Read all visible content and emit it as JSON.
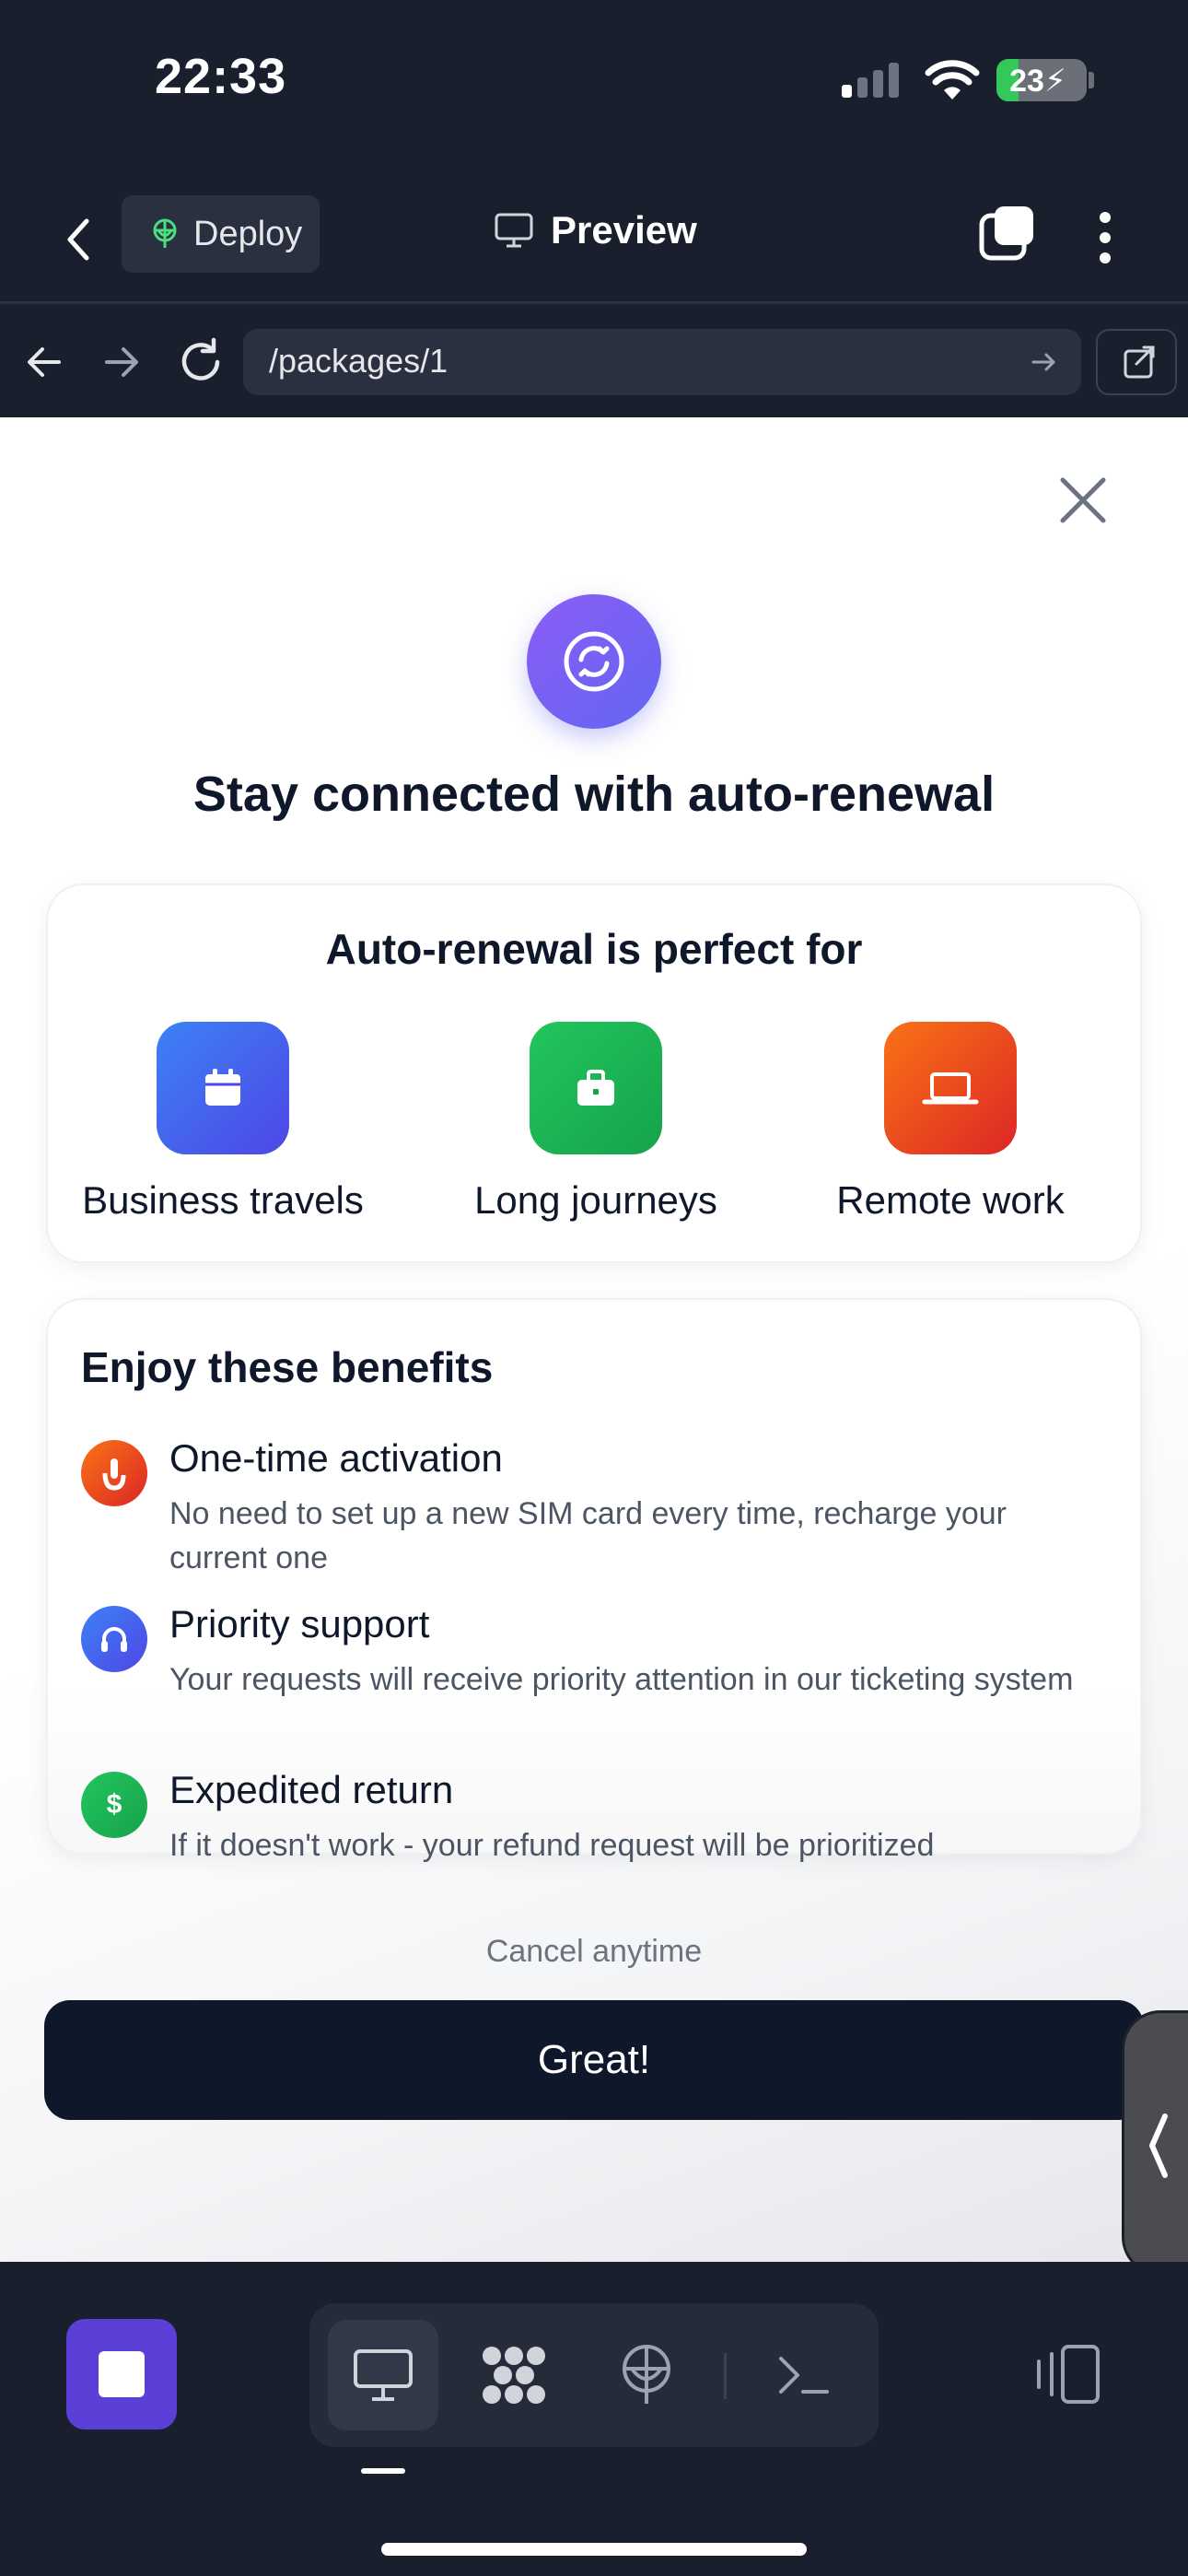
{
  "status_bar": {
    "time": "22:33",
    "battery_level": "23",
    "battery_charging": true
  },
  "header": {
    "deploy_label": "Deploy",
    "preview_label": "Preview"
  },
  "browser": {
    "url": "/packages/1"
  },
  "dialog": {
    "title": "Stay connected with auto-renewal",
    "perfect_for_title": "Auto-renewal is perfect for",
    "use_cases": [
      {
        "label": "Business travels",
        "icon": "calendar-icon",
        "color": "#4f46e5"
      },
      {
        "label": "Long journeys",
        "icon": "briefcase-icon",
        "color": "#16a34a"
      },
      {
        "label": "Remote work",
        "icon": "laptop-icon",
        "color": "#ea580c"
      }
    ],
    "benefits_title": "Enjoy these benefits",
    "benefits": [
      {
        "title": "One-time activation",
        "description": "No need to set up a new SIM card every time, recharge your current one",
        "icon": "tap-icon",
        "color": "#ea580c"
      },
      {
        "title": "Priority support",
        "description": "Your requests will receive priority attention in our ticketing system",
        "icon": "headphones-icon",
        "color": "#4f46e5"
      },
      {
        "title": "Expedited return",
        "description": "If it doesn't work - your refund request will be prioritized",
        "icon": "dollar-icon",
        "color": "#16a34a"
      }
    ],
    "cancel_note": "Cancel anytime",
    "cta_label": "Great!"
  },
  "toolbar": {
    "tools": [
      "desktop-icon",
      "apps-icon",
      "deploy-icon",
      "terminal-icon"
    ],
    "active_tool": "desktop-icon"
  },
  "colors": {
    "dark_bg": "#1a1f2e",
    "accent_purple": "#5b3fd6",
    "cta_bg": "#0f172a"
  }
}
